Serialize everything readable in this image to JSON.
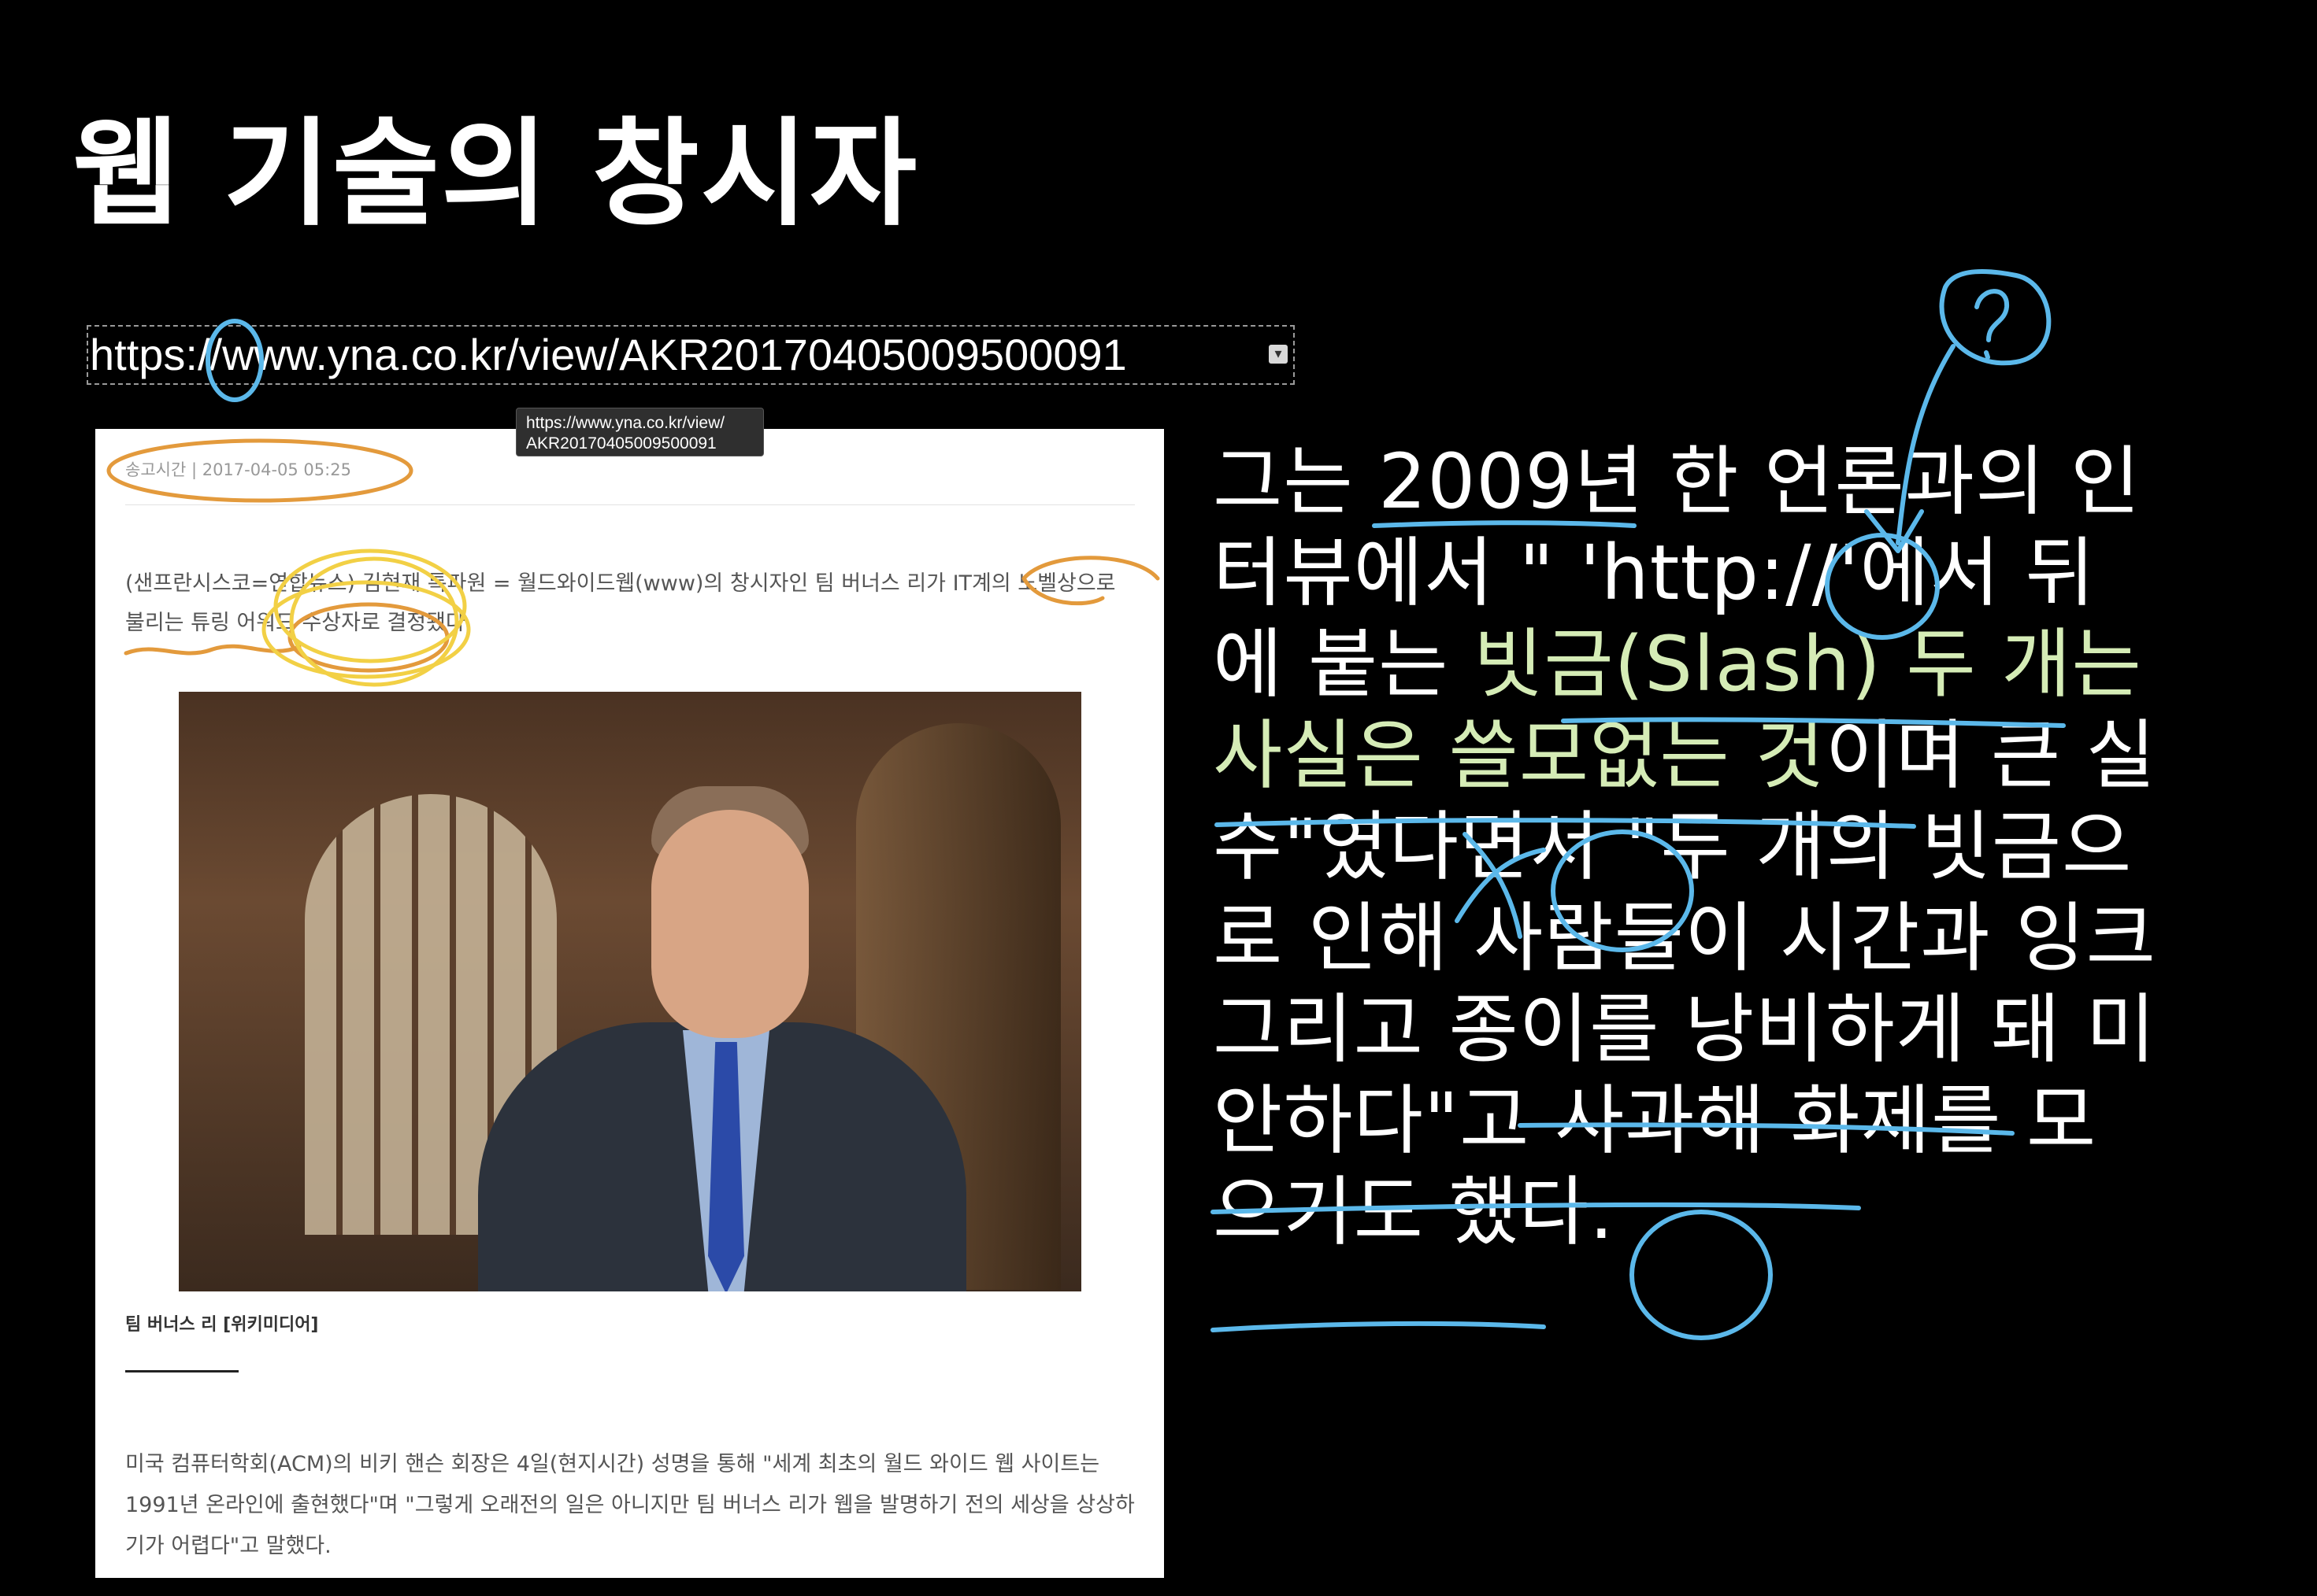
{
  "slide": {
    "title": "웹 기술의 창시자"
  },
  "link": {
    "url": "https://www.yna.co.kr/view/AKR20170405009500091",
    "tooltip_line1": "https://www.yna.co.kr/view/",
    "tooltip_line2": "AKR20170405009500091",
    "dropdown_icon": "chevron-down-icon"
  },
  "article": {
    "timestamp": "송고시간 | 2017-04-05 05:25",
    "lead": "(샌프란시스코=연합뉴스) 김현재 특파원 = 월드와이드웹(www)의 창시자인 팀 버너스 리가 IT계의 노벨상으로 불리는 튜링 어워드 수상자로 결정됐다.",
    "photo_caption": "팀 버너스 리 [위키미디어]",
    "body": "미국 컴퓨터학회(ACM)의 비키 핸슨 회장은 4일(현지시간) 성명을 통해 \"세계 최초의 월드 와이드 웹 사이트는 1991년 온라인에 출현했다\"며 \"그렇게 오래전의 일은 아니지만 팀 버너스 리가 웹을 발명하기 전의 세상을 상상하기가 어렵다\"고 말했다."
  },
  "quote": {
    "part1": "그는 2009년 한 언론과의 인터뷰에서 \" 'http://'에서 뒤에 붙는 ",
    "highlight": "빗금(Slash) 두 개는 사실은 쓸모없는 것",
    "part2": "이며 큰 실수\"였다면서 \"두 개의 빗금으로 인해 사람들이 시간과 잉크 그리고 종이를 낭비하게 돼 미안하다\"고 사과해 화제를 모으기도 했다."
  },
  "annotations": {
    "blue_ink": "#5bb8ea",
    "orange_ink": "#e39a3c",
    "yellow_ink": "#f2d045",
    "question_mark": "?"
  }
}
